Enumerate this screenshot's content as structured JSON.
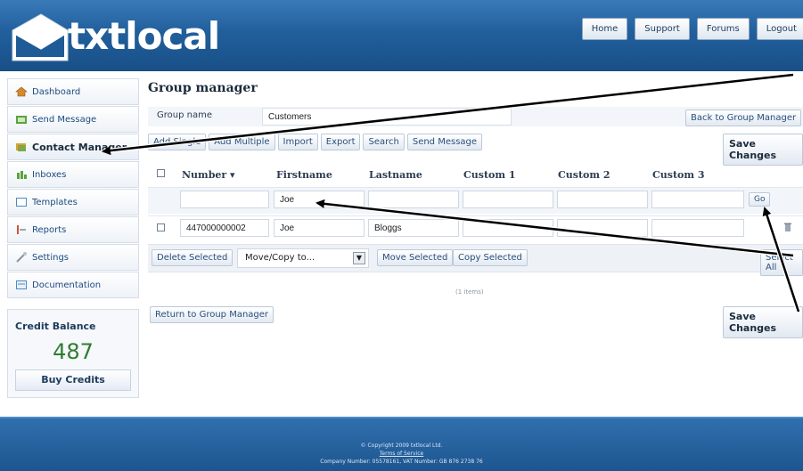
{
  "brand": {
    "name": "txtlocal"
  },
  "topnav": {
    "items": [
      "Home",
      "Support",
      "Forums",
      "Logout"
    ]
  },
  "sidebar": {
    "items": [
      {
        "label": "Dashboard",
        "icon": "house-icon",
        "active": false
      },
      {
        "label": "Send Message",
        "icon": "send-message-icon",
        "active": false
      },
      {
        "label": "Contact Manager",
        "icon": "contacts-icon",
        "active": true
      },
      {
        "label": "Inboxes",
        "icon": "inbox-icon",
        "active": false
      },
      {
        "label": "Templates",
        "icon": "template-icon",
        "active": false
      },
      {
        "label": "Reports",
        "icon": "reports-icon",
        "active": false
      },
      {
        "label": "Settings",
        "icon": "wrench-icon",
        "active": false
      },
      {
        "label": "Documentation",
        "icon": "document-icon",
        "active": false
      }
    ]
  },
  "credit": {
    "label": "Credit Balance",
    "value": "487",
    "buy_label": "Buy Credits"
  },
  "main": {
    "title": "Group manager",
    "group_name_label": "Group name",
    "group_name_value": "Customers",
    "back_button": "Back to Group Manager",
    "toolbar": [
      "Add Single",
      "Add Multiple",
      "Import",
      "Export",
      "Search",
      "Send Message"
    ],
    "save_changes": "Save Changes",
    "columns": [
      "Number ▾",
      "Firstname",
      "Lastname",
      "Custom 1",
      "Custom 2",
      "Custom 3"
    ],
    "search_row": {
      "firstname": "Joe",
      "go_label": "Go"
    },
    "rows": [
      {
        "number": "447000000002",
        "firstname": "Joe",
        "lastname": "Bloggs",
        "custom1": "",
        "custom2": "",
        "custom3": ""
      }
    ],
    "bulk": {
      "delete_selected": "Delete Selected",
      "move_copy_to": "Move/Copy to...",
      "move_selected": "Move Selected",
      "copy_selected": "Copy Selected",
      "select_all": "Select All"
    },
    "item_count": "(1 items)",
    "return_button": "Return to Group Manager",
    "save_changes_bottom": "Save Changes"
  },
  "footer": {
    "copyright": "© Copyright 2009 txtlocal Ltd.",
    "terms": "Terms of Service",
    "company": "Company Number: 05578161, VAT Number: GB 876 2738 76"
  },
  "colors": {
    "header": "#215f9c",
    "accent_green": "#2e7d32",
    "arrow": "#000000"
  }
}
